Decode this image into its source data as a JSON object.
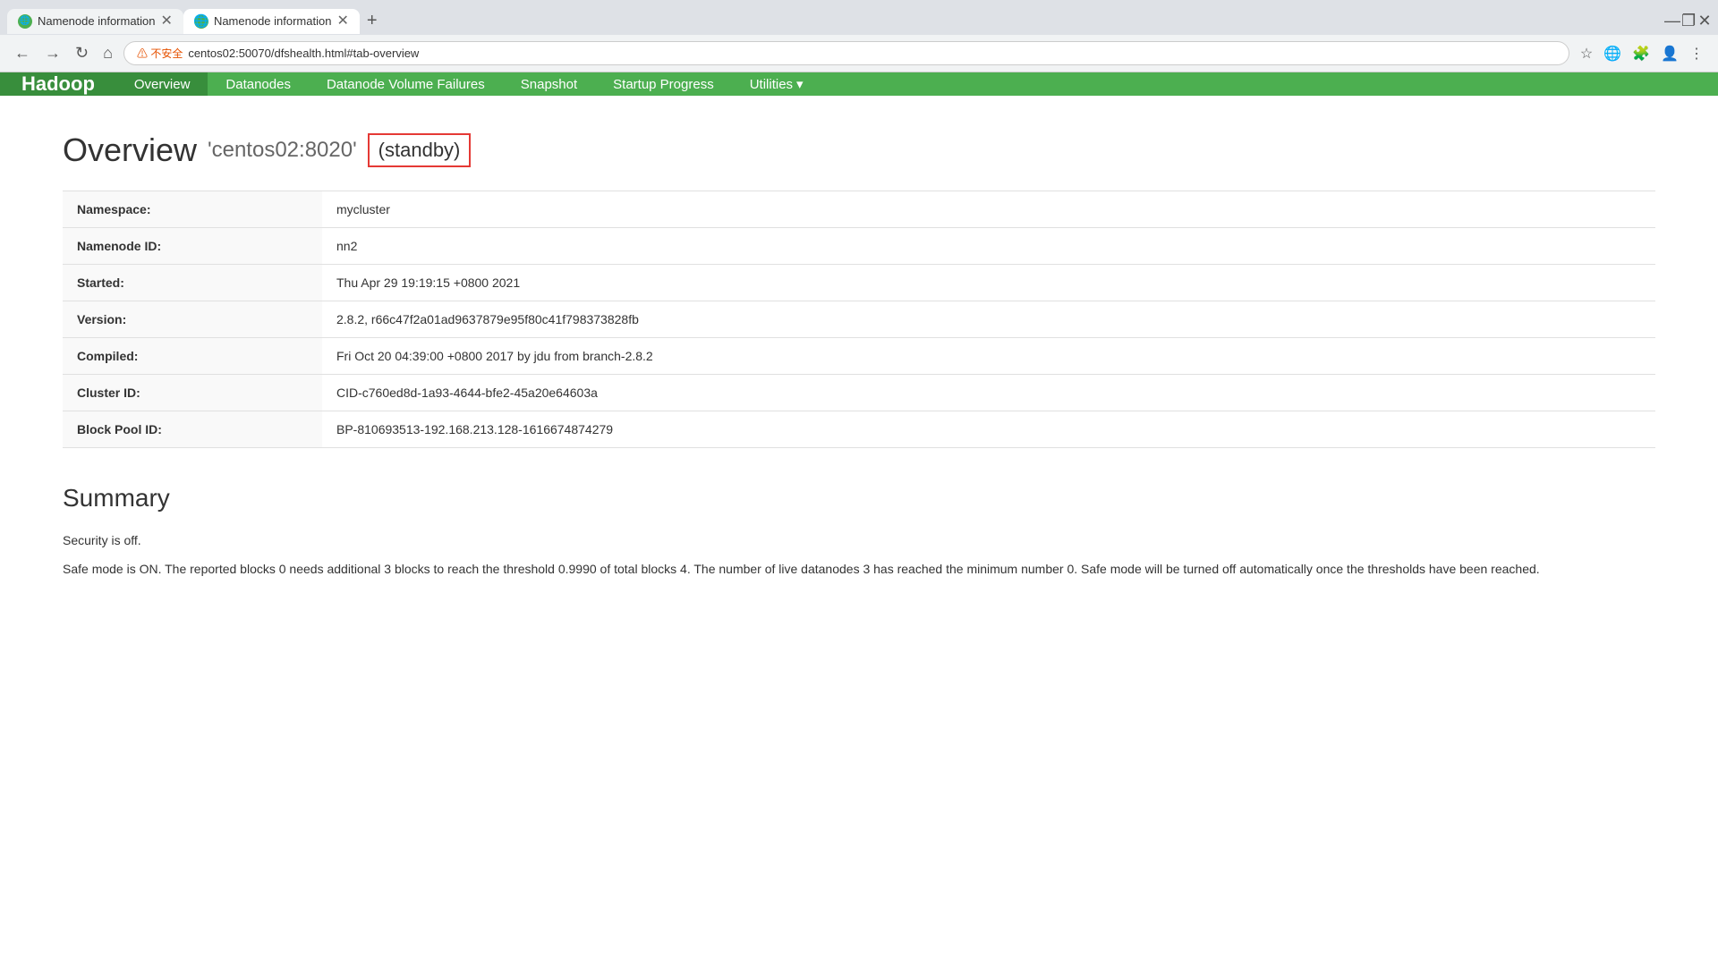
{
  "browser": {
    "tabs": [
      {
        "id": "tab1",
        "favicon": "globe",
        "label": "Namenode information",
        "active": false
      },
      {
        "id": "tab2",
        "favicon": "globe",
        "label": "Namenode information",
        "active": true
      }
    ],
    "address": "centos02:50070/dfshealth.html#tab-overview",
    "address_warning": "不安全",
    "window_controls": {
      "minimize": "—",
      "maximize": "❐",
      "close": "✕"
    }
  },
  "navbar": {
    "brand": "Hadoop",
    "items": [
      {
        "id": "overview",
        "label": "Overview",
        "active": true
      },
      {
        "id": "datanodes",
        "label": "Datanodes",
        "active": false
      },
      {
        "id": "datanode-volume-failures",
        "label": "Datanode Volume Failures",
        "active": false
      },
      {
        "id": "snapshot",
        "label": "Snapshot",
        "active": false
      },
      {
        "id": "startup-progress",
        "label": "Startup Progress",
        "active": false
      },
      {
        "id": "utilities",
        "label": "Utilities",
        "active": false,
        "dropdown": true
      }
    ]
  },
  "overview": {
    "title": "Overview",
    "host": "'centos02:8020'",
    "status_badge": "(standby)",
    "table_rows": [
      {
        "label": "Namespace:",
        "value": "mycluster"
      },
      {
        "label": "Namenode ID:",
        "value": "nn2"
      },
      {
        "label": "Started:",
        "value": "Thu Apr 29 19:19:15 +0800 2021"
      },
      {
        "label": "Version:",
        "value": "2.8.2, r66c47f2a01ad9637879e95f80c41f798373828fb"
      },
      {
        "label": "Compiled:",
        "value": "Fri Oct 20 04:39:00 +0800 2017 by jdu from branch-2.8.2"
      },
      {
        "label": "Cluster ID:",
        "value": "CID-c760ed8d-1a93-4644-bfe2-45a20e64603a"
      },
      {
        "label": "Block Pool ID:",
        "value": "BP-810693513-192.168.213.128-1616674874279"
      }
    ]
  },
  "summary": {
    "title": "Summary",
    "security_text": "Security is off.",
    "safemode_text": "Safe mode is ON. The reported blocks 0 needs additional 3 blocks to reach the threshold 0.9990 of total blocks 4. The number of live datanodes 3 has reached the minimum number 0. Safe mode will be turned off automatically once the thresholds have been reached."
  }
}
